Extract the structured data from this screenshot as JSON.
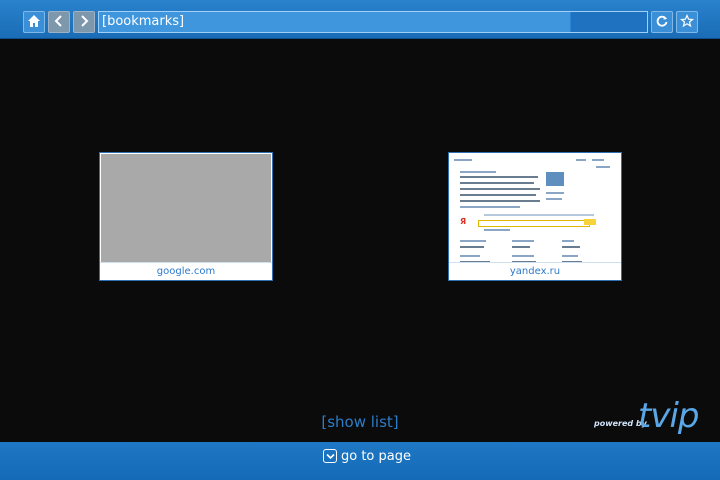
{
  "toolbar": {
    "home_icon": "home-icon",
    "back_icon": "chevron-left-icon",
    "forward_icon": "chevron-right-icon",
    "address": "[bookmarks]",
    "reload_icon": "refresh-icon",
    "bookmark_icon": "star-icon"
  },
  "bookmarks": [
    {
      "label": "google.com"
    },
    {
      "label": "yandex.ru"
    }
  ],
  "show_list_label": "[show list]",
  "brand": {
    "powered_by": "powered by",
    "logo": "tvip"
  },
  "footer": {
    "go_to_page_label": "go to page",
    "icon": "chevron-down-icon"
  },
  "colors": {
    "bar_blue": "#1a6cb6",
    "accent": "#2c7dc9",
    "background": "#0b0b0b"
  }
}
